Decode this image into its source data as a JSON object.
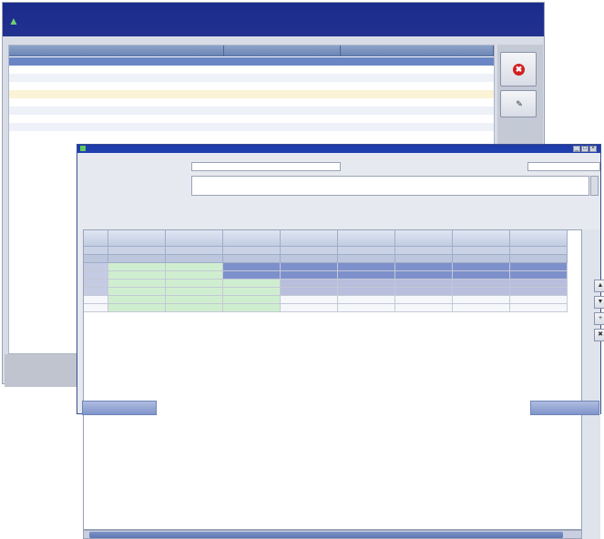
{
  "window1": {
    "title": "",
    "columns": [
      "",
      "",
      ""
    ],
    "rows": [
      {
        "name": "",
        "date": "",
        "status": ""
      },
      {
        "name": "",
        "date": "",
        "status": ""
      },
      {
        "name": "",
        "date": "",
        "status": ""
      },
      {
        "name": "",
        "date": "",
        "status": ""
      },
      {
        "name": "",
        "date": "",
        "status": ""
      },
      {
        "name": "",
        "date": "",
        "status": ""
      },
      {
        "name": "",
        "date": "",
        "status": ""
      },
      {
        "name": "",
        "date": "",
        "status": ""
      },
      {
        "name": "",
        "date": "",
        "status": ""
      }
    ],
    "del_icon": "delete-icon",
    "edit_icon": "edit-icon"
  },
  "window2": {
    "title": "",
    "name_label": "",
    "name_value": "",
    "desc_label": "",
    "desc_value": "",
    "date_label": "",
    "date_value": "",
    "grid": {
      "headers": [
        "",
        "",
        "",
        "",
        "",
        "",
        "",
        "",
        ""
      ],
      "subheaders": [
        "",
        "",
        "",
        "",
        "",
        "",
        "",
        "",
        ""
      ],
      "params": [
        "",
        "",
        "",
        "",
        "",
        "",
        "",
        "",
        ""
      ],
      "rows": [
        {
          "num": "",
          "style": [
            "c-lav",
            "c-green",
            "c-green",
            "c-blue",
            "c-blue",
            "c-blue",
            "c-blue",
            "c-blue",
            "c-blue"
          ],
          "cells": [
            "",
            "",
            "",
            "",
            "",
            "",
            "",
            "",
            ""
          ]
        },
        {
          "num": "",
          "style": [
            "c-lav",
            "c-green",
            "c-green",
            "c-blue",
            "c-blue",
            "c-blue",
            "c-blue",
            "c-blue",
            "c-blue"
          ],
          "cells": [
            "",
            "",
            "",
            "",
            "",
            "",
            "",
            "",
            ""
          ]
        },
        {
          "num": "",
          "style": [
            "c-lav",
            "c-green",
            "c-green",
            "c-green",
            "c-lav2",
            "c-lav2",
            "c-lav2",
            "c-lav2",
            "c-lav2"
          ],
          "cells": [
            "",
            "",
            "",
            "",
            "",
            "",
            "",
            "",
            ""
          ]
        },
        {
          "num": "",
          "style": [
            "c-lav",
            "c-green",
            "c-green",
            "c-green",
            "c-lav2",
            "c-lav2",
            "c-lav2",
            "c-lav2",
            "c-lav2"
          ],
          "cells": [
            "",
            "",
            "",
            "",
            "",
            "",
            "",
            "",
            ""
          ]
        },
        {
          "num": "",
          "style": [
            "c-white",
            "c-green",
            "c-green",
            "c-green",
            "c-white",
            "c-white",
            "c-white",
            "c-white",
            "c-white"
          ],
          "cells": [
            "",
            "",
            "",
            "",
            "",
            "",
            "",
            "",
            ""
          ]
        },
        {
          "num": "",
          "style": [
            "c-white",
            "c-green",
            "c-green",
            "c-green",
            "c-white",
            "c-white",
            "c-white",
            "c-white",
            "c-white"
          ],
          "cells": [
            "",
            "",
            "",
            "",
            "",
            "",
            "",
            "",
            ""
          ]
        }
      ]
    },
    "save_label": "",
    "close_label": ""
  }
}
